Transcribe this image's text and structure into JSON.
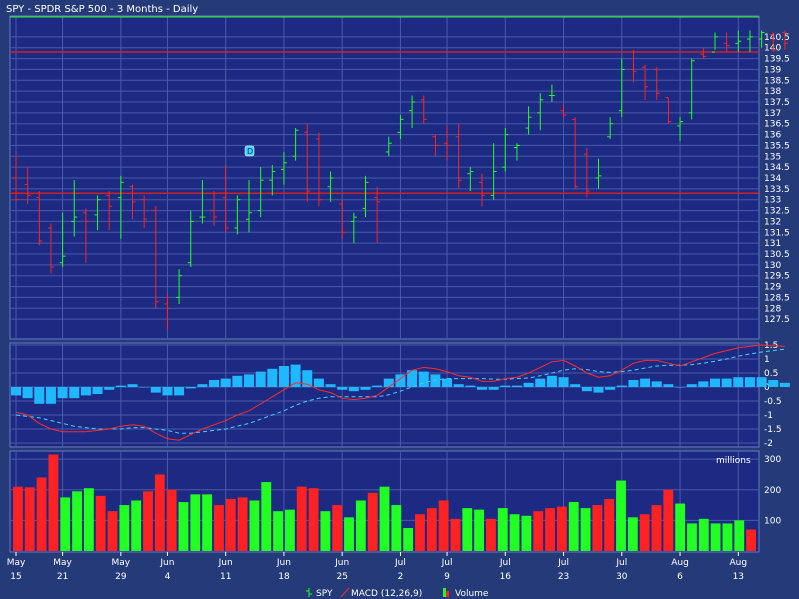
{
  "chart_data": {
    "type": "ohlc",
    "title": "SPY - SPDR S&P 500 - 3 Months - Daily",
    "colors": {
      "background": "#253a78",
      "panel": "#1c2a83",
      "grid": "#4a5aa8",
      "up": "#22ff22",
      "down": "#ff2222",
      "macd_line": "#ff2a2a",
      "signal_line": "#3fd6ff",
      "histogram": "#1fb8ff",
      "reference_line": "#cc2222"
    },
    "price_panel": {
      "ylim": [
        127,
        141
      ],
      "yticks": [
        "127.5",
        "128",
        "128.5",
        "129",
        "129.5",
        "130",
        "130.5",
        "131",
        "131.5",
        "132",
        "132.5",
        "133",
        "133.5",
        "134",
        "134.5",
        "135",
        "135.5",
        "136",
        "136.5",
        "137",
        "137.5",
        "138",
        "138.5",
        "139",
        "139.5",
        "140",
        "140.5"
      ],
      "reference_lines": [
        133.3,
        139.8
      ],
      "badge": {
        "text": "D",
        "index": 20,
        "value": 135.2
      },
      "bars": [
        {
          "o": 134.0,
          "h": 135.1,
          "l": 132.9,
          "c": 133.0
        },
        {
          "o": 133.7,
          "h": 134.5,
          "l": 132.8,
          "c": 133.2
        },
        {
          "o": 133.1,
          "h": 133.4,
          "l": 130.9,
          "c": 131.1
        },
        {
          "o": 131.7,
          "h": 131.9,
          "l": 129.6,
          "c": 129.9
        },
        {
          "o": 130.1,
          "h": 132.4,
          "l": 129.9,
          "c": 130.4
        },
        {
          "o": 132.0,
          "h": 133.9,
          "l": 131.3,
          "c": 132.2
        },
        {
          "o": 132.4,
          "h": 132.6,
          "l": 130.1,
          "c": 132.0
        },
        {
          "o": 132.3,
          "h": 133.2,
          "l": 131.6,
          "c": 133.0
        },
        {
          "o": 133.2,
          "h": 133.4,
          "l": 131.6,
          "c": 132.7
        },
        {
          "o": 133.1,
          "h": 134.1,
          "l": 131.2,
          "c": 133.8
        },
        {
          "o": 133.6,
          "h": 133.7,
          "l": 132.1,
          "c": 132.9
        },
        {
          "o": 133.0,
          "h": 133.2,
          "l": 131.7,
          "c": 132.1
        },
        {
          "o": 132.5,
          "h": 132.7,
          "l": 128.0,
          "c": 128.3
        },
        {
          "o": 128.2,
          "h": 128.7,
          "l": 127.0,
          "c": 128.0
        },
        {
          "o": 128.5,
          "h": 129.8,
          "l": 128.2,
          "c": 129.5
        },
        {
          "o": 130.1,
          "h": 132.5,
          "l": 129.9,
          "c": 132.0
        },
        {
          "o": 132.2,
          "h": 133.9,
          "l": 131.9,
          "c": 132.2
        },
        {
          "o": 132.5,
          "h": 133.4,
          "l": 131.8,
          "c": 132.2
        },
        {
          "o": 133.1,
          "h": 134.6,
          "l": 131.5,
          "c": 131.7
        },
        {
          "o": 131.7,
          "h": 133.2,
          "l": 131.4,
          "c": 133.0
        },
        {
          "o": 132.1,
          "h": 133.9,
          "l": 131.5,
          "c": 132.4
        },
        {
          "o": 132.5,
          "h": 134.5,
          "l": 132.2,
          "c": 133.9
        },
        {
          "o": 133.9,
          "h": 134.6,
          "l": 133.2,
          "c": 134.3
        },
        {
          "o": 134.4,
          "h": 135.2,
          "l": 133.7,
          "c": 134.7
        },
        {
          "o": 135.0,
          "h": 136.3,
          "l": 134.8,
          "c": 136.2
        },
        {
          "o": 136.1,
          "h": 136.5,
          "l": 132.9,
          "c": 133.4
        },
        {
          "o": 135.8,
          "h": 136.1,
          "l": 132.7,
          "c": 133.0
        },
        {
          "o": 133.6,
          "h": 134.3,
          "l": 132.9,
          "c": 134.0
        },
        {
          "o": 132.8,
          "h": 133.0,
          "l": 131.2,
          "c": 131.5
        },
        {
          "o": 132.0,
          "h": 132.4,
          "l": 131.0,
          "c": 132.2
        },
        {
          "o": 132.6,
          "h": 134.1,
          "l": 132.2,
          "c": 133.8
        },
        {
          "o": 133.1,
          "h": 133.6,
          "l": 131.0,
          "c": 132.9
        },
        {
          "o": 135.2,
          "h": 135.9,
          "l": 135.0,
          "c": 135.6
        },
        {
          "o": 136.1,
          "h": 136.9,
          "l": 135.8,
          "c": 136.7
        },
        {
          "o": 137.1,
          "h": 137.8,
          "l": 136.3,
          "c": 137.5
        },
        {
          "o": 137.6,
          "h": 137.8,
          "l": 136.5,
          "c": 136.7
        },
        {
          "o": 135.9,
          "h": 136.0,
          "l": 135.0,
          "c": 135.5
        },
        {
          "o": 135.6,
          "h": 136.4,
          "l": 134.8,
          "c": 135.5
        },
        {
          "o": 135.9,
          "h": 136.5,
          "l": 133.5,
          "c": 133.9
        },
        {
          "o": 134.2,
          "h": 134.5,
          "l": 133.4,
          "c": 134.3
        },
        {
          "o": 133.8,
          "h": 134.2,
          "l": 132.7,
          "c": 133.2
        },
        {
          "o": 133.2,
          "h": 135.6,
          "l": 133.0,
          "c": 134.3
        },
        {
          "o": 134.5,
          "h": 136.3,
          "l": 134.3,
          "c": 136.0
        },
        {
          "o": 135.4,
          "h": 135.6,
          "l": 134.8,
          "c": 135.5
        },
        {
          "o": 136.3,
          "h": 137.3,
          "l": 136.0,
          "c": 136.8
        },
        {
          "o": 137.0,
          "h": 137.9,
          "l": 136.2,
          "c": 137.6
        },
        {
          "o": 137.8,
          "h": 138.3,
          "l": 137.5,
          "c": 137.8
        },
        {
          "o": 137.1,
          "h": 137.4,
          "l": 136.8,
          "c": 136.9
        },
        {
          "o": 136.7,
          "h": 136.8,
          "l": 133.5,
          "c": 133.6
        },
        {
          "o": 135.1,
          "h": 135.4,
          "l": 133.1,
          "c": 133.4
        },
        {
          "o": 134.0,
          "h": 134.9,
          "l": 133.5,
          "c": 134.1
        },
        {
          "o": 135.9,
          "h": 136.8,
          "l": 135.8,
          "c": 136.5
        },
        {
          "o": 137.1,
          "h": 139.5,
          "l": 136.8,
          "c": 139.0
        },
        {
          "o": 139.0,
          "h": 139.9,
          "l": 138.4,
          "c": 138.9
        },
        {
          "o": 139.1,
          "h": 139.2,
          "l": 137.6,
          "c": 138.2
        },
        {
          "o": 139.0,
          "h": 139.1,
          "l": 137.6,
          "c": 137.9
        },
        {
          "o": 137.7,
          "h": 137.7,
          "l": 136.5,
          "c": 136.6
        },
        {
          "o": 136.4,
          "h": 136.8,
          "l": 135.7,
          "c": 136.6
        },
        {
          "o": 137.0,
          "h": 139.5,
          "l": 136.7,
          "c": 139.4
        },
        {
          "o": 139.7,
          "h": 140.0,
          "l": 139.5,
          "c": 139.6
        },
        {
          "o": 139.8,
          "h": 140.7,
          "l": 139.9,
          "c": 140.5
        },
        {
          "o": 140.2,
          "h": 140.7,
          "l": 139.8,
          "c": 140.1
        },
        {
          "o": 140.2,
          "h": 140.8,
          "l": 139.8,
          "c": 140.3
        },
        {
          "o": 140.4,
          "h": 140.8,
          "l": 139.8,
          "c": 140.5
        },
        {
          "o": 140.4,
          "h": 140.8,
          "l": 140.0,
          "c": 140.7
        },
        {
          "o": 140.6,
          "h": 140.7,
          "l": 139.8,
          "c": 139.9
        },
        {
          "o": 140.7,
          "h": 140.8,
          "l": 139.9,
          "c": 140.2
        }
      ]
    },
    "macd_panel": {
      "ylim": [
        -2,
        1.5
      ],
      "yticks": [
        "1.5",
        "1",
        "0.5",
        "0",
        "-0.5",
        "-1",
        "-1.5",
        "-2"
      ],
      "macd": [
        -0.9,
        -1.0,
        -1.3,
        -1.5,
        -1.6,
        -1.6,
        -1.6,
        -1.55,
        -1.5,
        -1.4,
        -1.35,
        -1.4,
        -1.65,
        -1.85,
        -1.9,
        -1.7,
        -1.5,
        -1.35,
        -1.2,
        -1.0,
        -0.85,
        -0.6,
        -0.35,
        -0.1,
        0.15,
        0.1,
        -0.1,
        -0.2,
        -0.4,
        -0.45,
        -0.4,
        -0.3,
        0.0,
        0.3,
        0.6,
        0.7,
        0.65,
        0.55,
        0.4,
        0.35,
        0.2,
        0.2,
        0.3,
        0.35,
        0.5,
        0.7,
        0.9,
        0.95,
        0.75,
        0.5,
        0.35,
        0.4,
        0.6,
        0.85,
        0.95,
        0.95,
        0.85,
        0.75,
        0.9,
        1.05,
        1.2,
        1.3,
        1.4,
        1.45,
        1.5,
        1.48,
        1.45
      ],
      "signal": [
        -1.0,
        -1.05,
        -1.1,
        -1.2,
        -1.3,
        -1.4,
        -1.45,
        -1.5,
        -1.5,
        -1.5,
        -1.45,
        -1.45,
        -1.5,
        -1.55,
        -1.65,
        -1.65,
        -1.6,
        -1.55,
        -1.5,
        -1.4,
        -1.3,
        -1.15,
        -1.0,
        -0.85,
        -0.65,
        -0.5,
        -0.4,
        -0.35,
        -0.35,
        -0.35,
        -0.35,
        -0.35,
        -0.28,
        -0.15,
        0.0,
        0.15,
        0.25,
        0.3,
        0.3,
        0.3,
        0.3,
        0.28,
        0.28,
        0.3,
        0.32,
        0.4,
        0.5,
        0.6,
        0.65,
        0.62,
        0.55,
        0.52,
        0.55,
        0.6,
        0.68,
        0.75,
        0.78,
        0.78,
        0.8,
        0.85,
        0.92,
        1.0,
        1.1,
        1.18,
        1.25,
        1.3,
        1.35
      ],
      "histogram": [
        -0.3,
        -0.4,
        -0.6,
        -0.6,
        -0.4,
        -0.4,
        -0.3,
        -0.25,
        -0.1,
        0.05,
        0.1,
        0.0,
        -0.2,
        -0.3,
        -0.3,
        -0.05,
        0.1,
        0.25,
        0.3,
        0.4,
        0.45,
        0.55,
        0.65,
        0.75,
        0.8,
        0.6,
        0.3,
        0.1,
        -0.1,
        -0.15,
        -0.1,
        0.05,
        0.3,
        0.45,
        0.6,
        0.55,
        0.45,
        0.3,
        0.1,
        0.05,
        -0.1,
        -0.1,
        0.05,
        0.05,
        0.15,
        0.3,
        0.4,
        0.35,
        0.1,
        -0.15,
        -0.2,
        -0.1,
        0.05,
        0.25,
        0.3,
        0.2,
        0.1,
        0.0,
        0.1,
        0.2,
        0.3,
        0.3,
        0.35,
        0.35,
        0.35,
        0.25,
        0.15
      ]
    },
    "volume_panel": {
      "unit_label": "millions",
      "ylim": [
        0,
        320
      ],
      "yticks": [
        "300",
        "200",
        "100"
      ],
      "values": [
        210,
        208,
        240,
        315,
        175,
        195,
        205,
        180,
        130,
        150,
        165,
        195,
        250,
        200,
        160,
        185,
        185,
        150,
        170,
        175,
        165,
        225,
        130,
        135,
        210,
        205,
        130,
        150,
        110,
        165,
        190,
        210,
        150,
        75,
        120,
        140,
        165,
        105,
        140,
        135,
        105,
        140,
        120,
        115,
        130,
        140,
        145,
        160,
        140,
        150,
        170,
        230,
        110,
        120,
        150,
        200,
        155,
        90,
        105,
        90,
        90,
        100,
        70
      ],
      "directions": [
        "down",
        "down",
        "down",
        "down",
        "up",
        "up",
        "up",
        "down",
        "down",
        "up",
        "up",
        "down",
        "down",
        "down",
        "up",
        "up",
        "up",
        "down",
        "down",
        "down",
        "up",
        "up",
        "up",
        "up",
        "down",
        "down",
        "up",
        "down",
        "up",
        "up",
        "down",
        "up",
        "up",
        "up",
        "down",
        "down",
        "down",
        "down",
        "up",
        "up",
        "down",
        "up",
        "up",
        "up",
        "down",
        "down",
        "down",
        "up",
        "up",
        "down",
        "down",
        "up",
        "up",
        "down",
        "down",
        "down",
        "up",
        "up",
        "up",
        "up",
        "up",
        "up",
        "down"
      ]
    },
    "x_ticks": [
      {
        "month": "May",
        "day": "15",
        "index": 0
      },
      {
        "month": "May",
        "day": "21",
        "index": 4
      },
      {
        "month": "May",
        "day": "29",
        "index": 9
      },
      {
        "month": "Jun",
        "day": "4",
        "index": 13
      },
      {
        "month": "Jun",
        "day": "11",
        "index": 18
      },
      {
        "month": "Jun",
        "day": "18",
        "index": 23
      },
      {
        "month": "Jun",
        "day": "25",
        "index": 28
      },
      {
        "month": "Jul",
        "day": "2",
        "index": 33
      },
      {
        "month": "Jul",
        "day": "9",
        "index": 37
      },
      {
        "month": "Jul",
        "day": "16",
        "index": 42
      },
      {
        "month": "Jul",
        "day": "23",
        "index": 47
      },
      {
        "month": "Jul",
        "day": "30",
        "index": 52
      },
      {
        "month": "Aug",
        "day": "6",
        "index": 57
      },
      {
        "month": "Aug",
        "day": "13",
        "index": 62
      }
    ],
    "legend": [
      {
        "label": "SPY",
        "icon": "ohlc-bar-icon"
      },
      {
        "label": "MACD (12,26,9)",
        "icon": "macd-line-icon"
      },
      {
        "label": "Volume",
        "icon": "volume-bar-icon"
      }
    ]
  }
}
